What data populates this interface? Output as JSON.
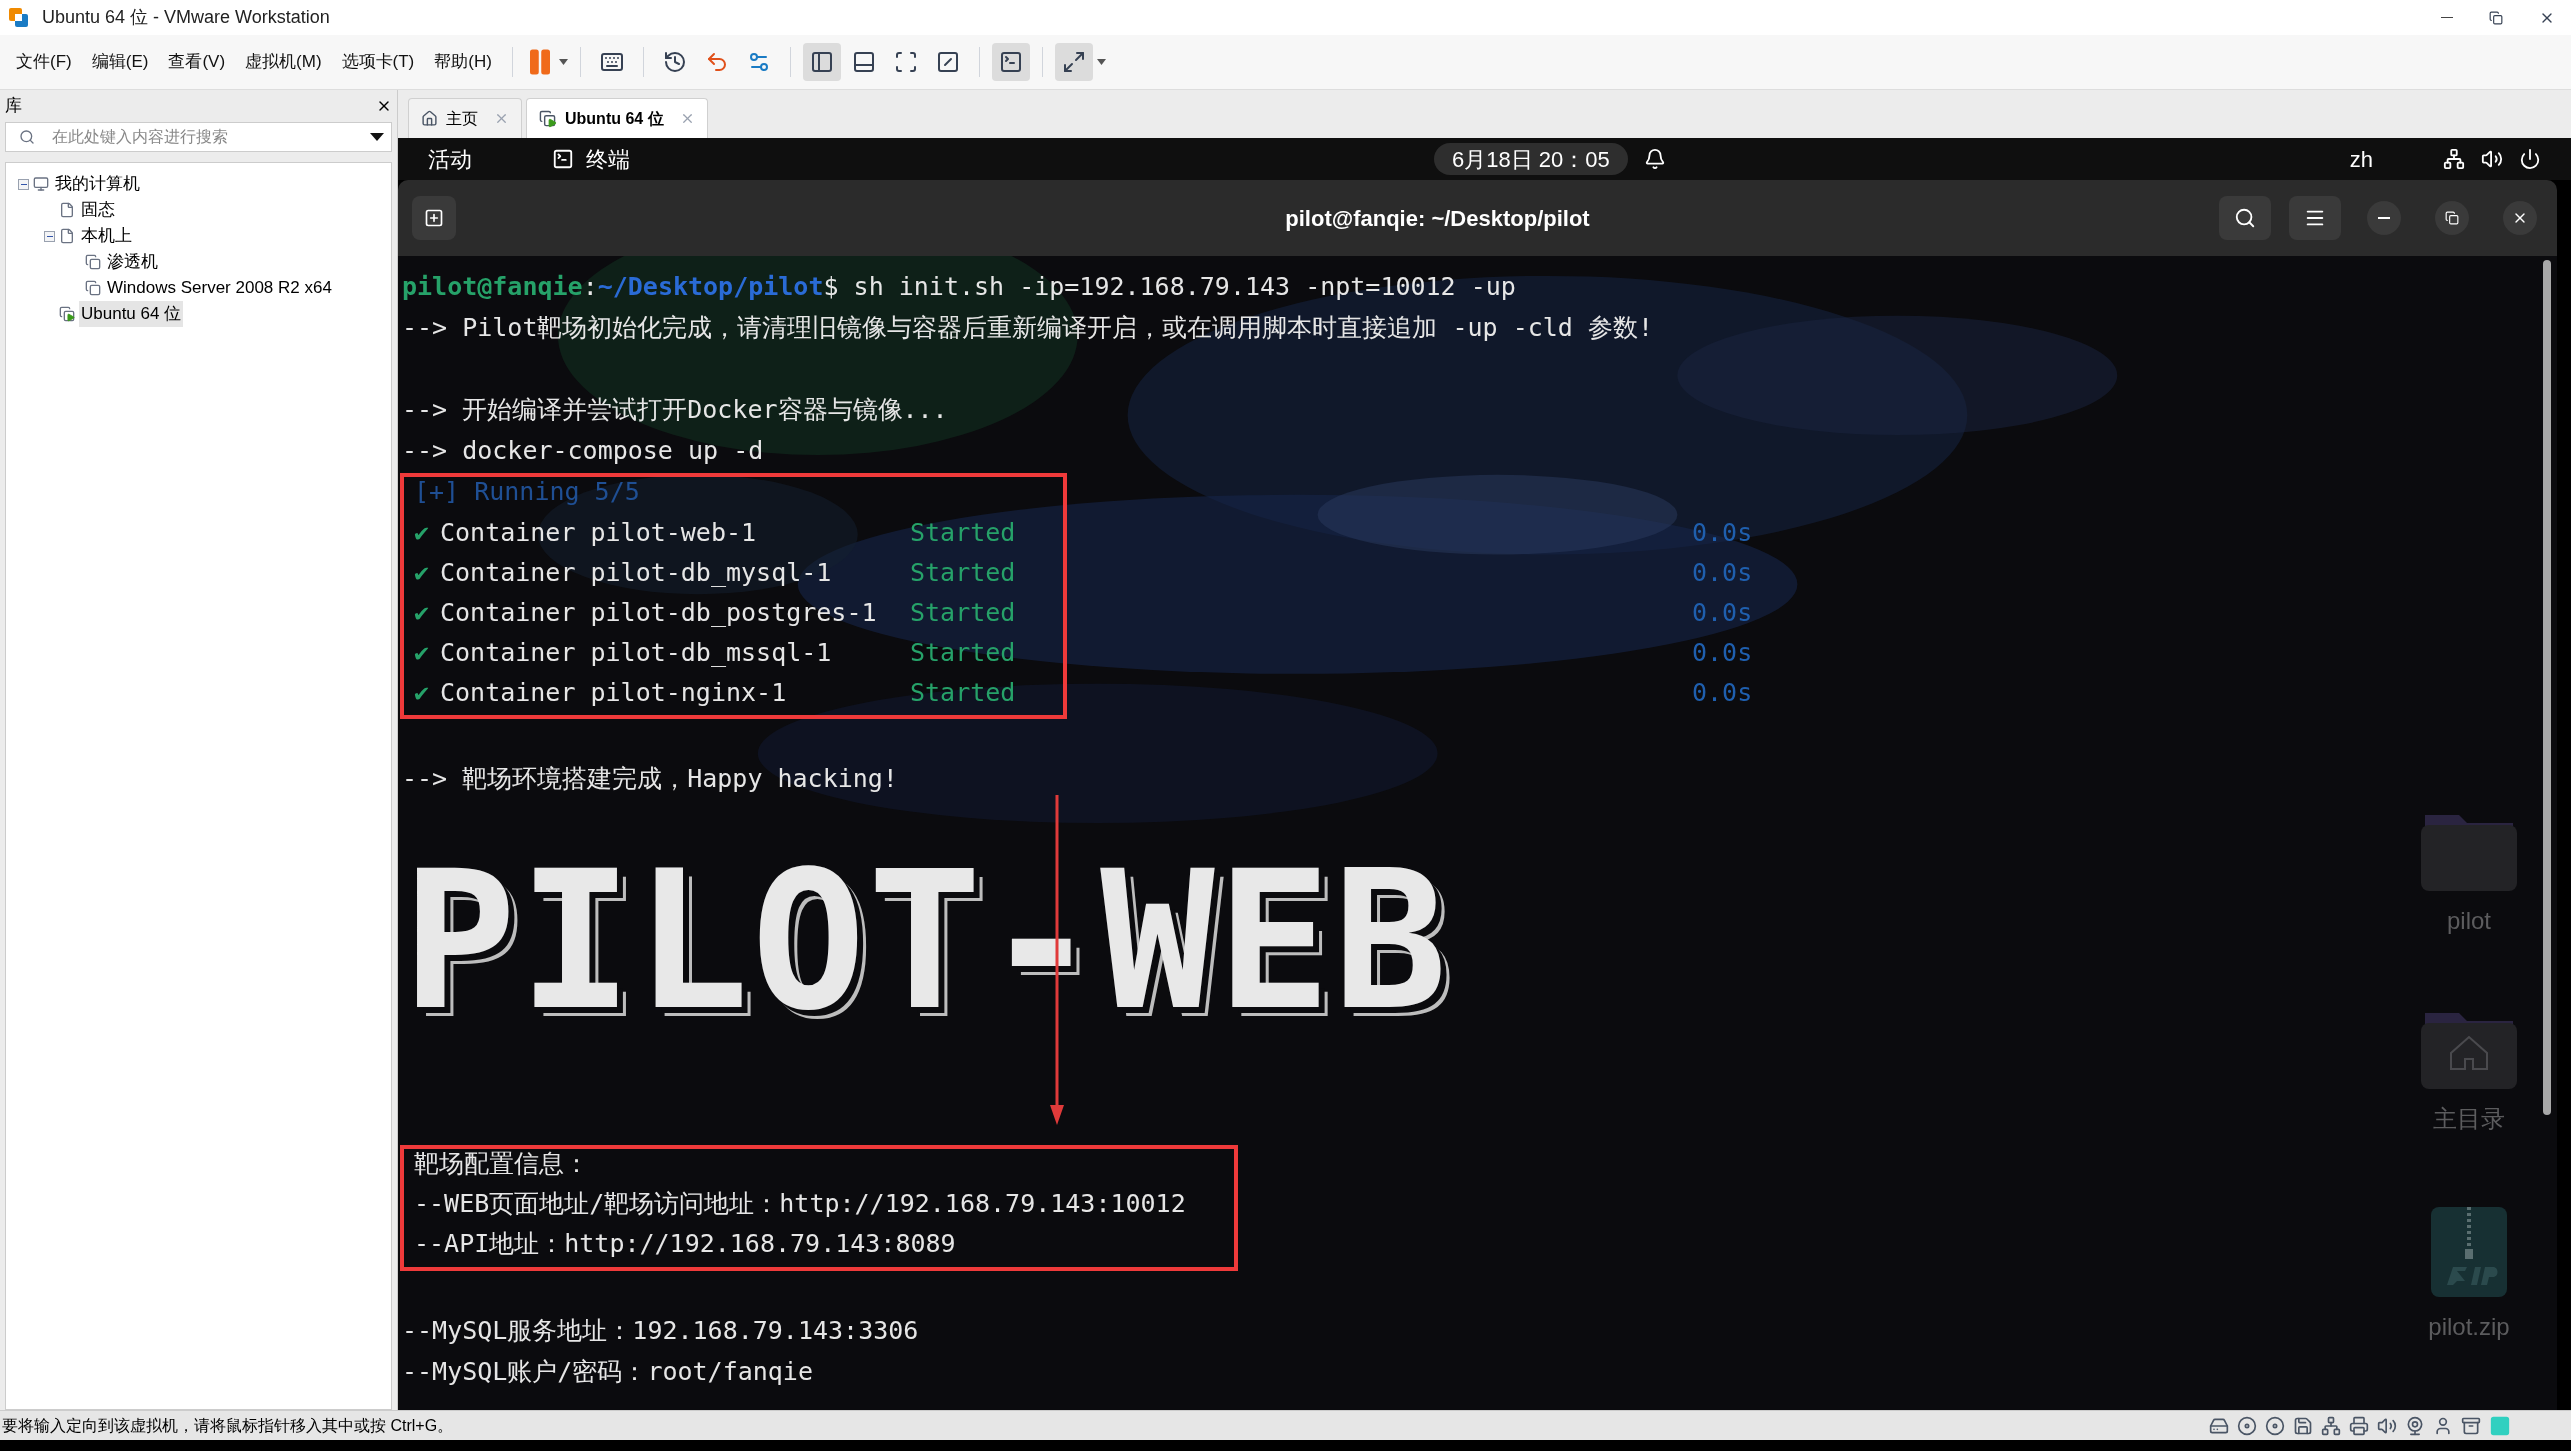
{
  "window": {
    "title": "Ubuntu 64 位 - VMware Workstation"
  },
  "menu": [
    "文件(F)",
    "编辑(E)",
    "查看(V)",
    "虚拟机(M)",
    "选项卡(T)",
    "帮助(H)"
  ],
  "library": {
    "title": "库",
    "search": {
      "placeholder": "在此处键入内容进行搜索"
    },
    "tree": [
      {
        "label": "我的计算机",
        "kind": "computer",
        "selected": false,
        "expanded": true,
        "children": [
          {
            "label": "固态",
            "kind": "folder",
            "selected": false
          },
          {
            "label": "本机上",
            "kind": "folder",
            "selected": false,
            "expanded": true,
            "children": [
              {
                "label": "渗透机",
                "kind": "vm",
                "selected": false,
                "running": false
              },
              {
                "label": "Windows Server 2008 R2 x64",
                "kind": "vm",
                "selected": false,
                "running": false
              }
            ]
          },
          {
            "label": "Ubuntu 64 位",
            "kind": "vm",
            "selected": true,
            "running": true
          }
        ]
      }
    ]
  },
  "tabs": [
    {
      "label": "主页",
      "kind": "home",
      "selected": false
    },
    {
      "label": "Ubuntu 64 位",
      "kind": "vm",
      "selected": true
    }
  ],
  "guest_bar": {
    "activities": "活动",
    "app": "终端",
    "clock": "6月18日 20：05",
    "language": "zh"
  },
  "terminal": {
    "title": "pilot@fanqie: ~/Desktop/pilot",
    "lines": [
      {
        "kind": "prompt",
        "user_host": "pilot@fanqie",
        "separator": ":",
        "path": "~/Desktop/pilot",
        "prompt_sign": "$",
        "command": "sh init.sh -ip=192.168.79.143 -npt=10012 -up"
      },
      {
        "kind": "text",
        "text": "--> Pilot靶场初始化完成，请清理旧镜像与容器后重新编译开启，或在调用脚本时直接追加 -up -cld 参数!"
      },
      {
        "kind": "blank"
      },
      {
        "kind": "text",
        "text": "--> 开始编译并尝试打开Docker容器与镜像..."
      },
      {
        "kind": "text",
        "text": "--> docker-compose up -d"
      },
      {
        "kind": "highlight",
        "lines": [
          {
            "kind": "running",
            "text": "[+] Running 5/5"
          },
          {
            "kind": "container",
            "mark": "✔",
            "name": "Container pilot-web-1",
            "status": "Started",
            "time": "0.0s"
          },
          {
            "kind": "container",
            "mark": "✔",
            "name": "Container pilot-db_mysql-1",
            "status": "Started",
            "time": "0.0s"
          },
          {
            "kind": "container",
            "mark": "✔",
            "name": "Container pilot-db_postgres-1",
            "status": "Started",
            "time": "0.0s"
          },
          {
            "kind": "container",
            "mark": "✔",
            "name": "Container pilot-db_mssql-1",
            "status": "Started",
            "time": "0.0s"
          },
          {
            "kind": "container",
            "mark": "✔",
            "name": "Container pilot-nginx-1",
            "status": "Started",
            "time": "0.0s"
          }
        ]
      },
      {
        "kind": "blank"
      },
      {
        "kind": "text",
        "text": "--> 靶场环境搭建完成，Happy hacking!"
      },
      {
        "kind": "banner",
        "text": "PILOT-WEB",
        "arrow": true
      },
      {
        "kind": "highlight",
        "lines": [
          {
            "kind": "text",
            "text": "靶场配置信息："
          },
          {
            "kind": "text",
            "text": "--WEB页面地址/靶场访问地址：http://192.168.79.143:10012"
          },
          {
            "kind": "text",
            "text": "--API地址：http://192.168.79.143:8089"
          }
        ]
      },
      {
        "kind": "blank"
      },
      {
        "kind": "text",
        "text": "--MySQL服务地址：192.168.79.143:3306"
      },
      {
        "kind": "text",
        "text": "--MySQL账户/密码：root/fanqie"
      }
    ]
  },
  "desktop_icons": [
    {
      "label": "pilot",
      "kind": "folder"
    },
    {
      "label": "主目录",
      "kind": "home"
    },
    {
      "label": "pilot.zip",
      "kind": "zip"
    }
  ],
  "status_bar": {
    "text": "要将输入定向到该虚拟机，请将鼠标指针移入其中或按 Ctrl+G。"
  }
}
